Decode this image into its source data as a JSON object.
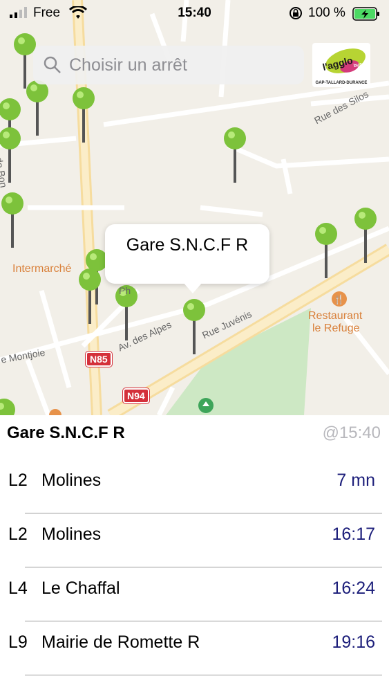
{
  "status": {
    "carrier": "Free",
    "time": "15:40",
    "battery": "100 %"
  },
  "search": {
    "placeholder": "Choisir un arrêt"
  },
  "logo": {
    "brand": "l'agglo bus",
    "tagline": "GAP-TALLARD-DURANCE"
  },
  "map": {
    "callout": "Gare S.N.C.F R",
    "labels": {
      "intermarche": "Intermarché",
      "restaurant_line1": "Restaurant",
      "restaurant_line2": "le Refuge",
      "rue_silos": "Rue des Silos",
      "av_alpes": "Av. des Alpes",
      "rue_juvenis": "Rue Juvénis",
      "montjoie": "e Montjoie",
      "de_bon": "de Bon",
      "ph": "Ph",
      "route_n85": "N85",
      "route_n94": "N94"
    }
  },
  "panel": {
    "stop_name": "Gare S.N.C.F R",
    "as_of": "@15:40",
    "departures": [
      {
        "line": "L2",
        "destination": "Molines",
        "time": "7 mn"
      },
      {
        "line": "L2",
        "destination": "Molines",
        "time": "16:17"
      },
      {
        "line": "L4",
        "destination": "Le Chaffal",
        "time": "16:24"
      },
      {
        "line": "L9",
        "destination": "Mairie de Romette R",
        "time": "19:16"
      }
    ]
  }
}
